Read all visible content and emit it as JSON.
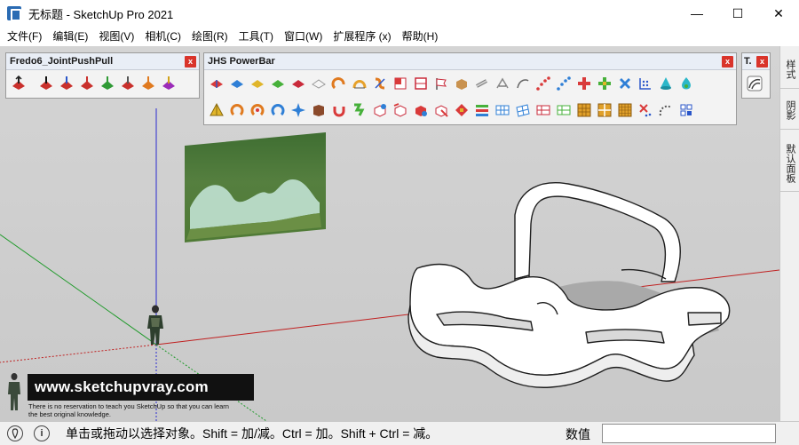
{
  "window": {
    "title": "无标题 - SketchUp Pro 2021",
    "minimize": "—",
    "maximize": "☐",
    "close": "✕"
  },
  "menu": [
    "文件(F)",
    "编辑(E)",
    "视图(V)",
    "相机(C)",
    "绘图(R)",
    "工具(T)",
    "窗口(W)",
    "扩展程序 (x)",
    "帮助(H)"
  ],
  "toolbars": {
    "fredo": {
      "title": "Fredo6_JointPushPull",
      "close": "x"
    },
    "jhs": {
      "title": "JHS PowerBar",
      "close": "x"
    },
    "small": {
      "title": "T.",
      "close": "x"
    }
  },
  "tray": {
    "tabs": [
      "样式",
      "阴影",
      "默认面板"
    ]
  },
  "status": {
    "hint": "单击或拖动以选择对象。Shift = 加/减。Ctrl = 加。Shift + Ctrl = 减。",
    "measure_label": "数值",
    "measure_value": ""
  },
  "watermark": {
    "site": "www.sketchupvray.com",
    "line1": "There is no reservation to teach you SketchUp so that you can learn",
    "line2": "the best original knowledge."
  },
  "colors": {
    "axis_red": "#c02020",
    "axis_green": "#1f9a2a",
    "axis_blue": "#2a2ad0",
    "close_red": "#d9342b"
  }
}
